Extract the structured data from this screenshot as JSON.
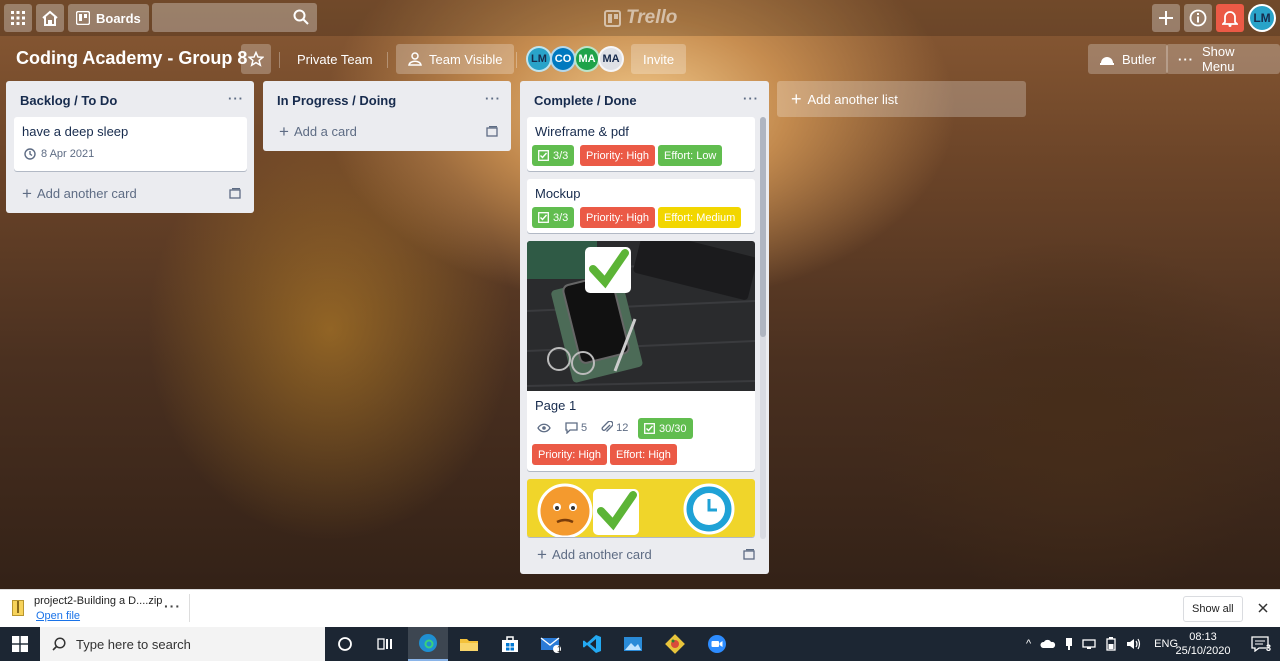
{
  "topbar": {
    "boards_label": "Boards",
    "logo_text": "Trello",
    "user_initials": "LM"
  },
  "board": {
    "title": "Coding Academy - Group 8",
    "team": "Private Team",
    "visibility": "Team Visible",
    "members": [
      {
        "initials": "LM",
        "color": "#29a3c9"
      },
      {
        "initials": "CO",
        "color": "#0079bf"
      },
      {
        "initials": "MA",
        "color": "#1fa34a"
      },
      {
        "initials": "MA",
        "color": "#dfe1e6"
      }
    ],
    "invite_label": "Invite",
    "butler_label": "Butler",
    "show_menu_label": "Show Menu"
  },
  "lists": {
    "backlog": {
      "title": "Backlog / To Do",
      "cards": [
        {
          "title": "have a deep sleep",
          "due": "8 Apr 2021"
        }
      ],
      "add_label": "Add another card"
    },
    "progress": {
      "title": "In Progress / Doing",
      "add_label": "Add a card"
    },
    "done": {
      "title": "Complete / Done",
      "cards": [
        {
          "title": "Wireframe & pdf",
          "checklist": "3/3",
          "labels": [
            "Priority: High",
            "Effort: Low"
          ]
        },
        {
          "title": "Mockup",
          "checklist": "3/3",
          "labels": [
            "Priority: High",
            "Effort: Medium"
          ]
        },
        {
          "title": "Page 1",
          "comments": "5",
          "attachments": "12",
          "checklist": "30/30",
          "labels": [
            "Priority: High",
            "Effort: High"
          ]
        }
      ],
      "add_label": "Add another card"
    },
    "add_list_label": "Add another list"
  },
  "colors": {
    "green": "#61bd4f",
    "red": "#eb5a46",
    "yellow": "#f2d600",
    "list_bg": "#ebecf0"
  },
  "download": {
    "filename": "project2-Building a D....zip",
    "open_label": "Open file",
    "show_all": "Show all"
  },
  "taskbar": {
    "search_placeholder": "Type here to search",
    "lang": "ENG",
    "time": "08:13",
    "date": "25/10/2020",
    "mail_badge": "1",
    "notif_count": "3"
  }
}
